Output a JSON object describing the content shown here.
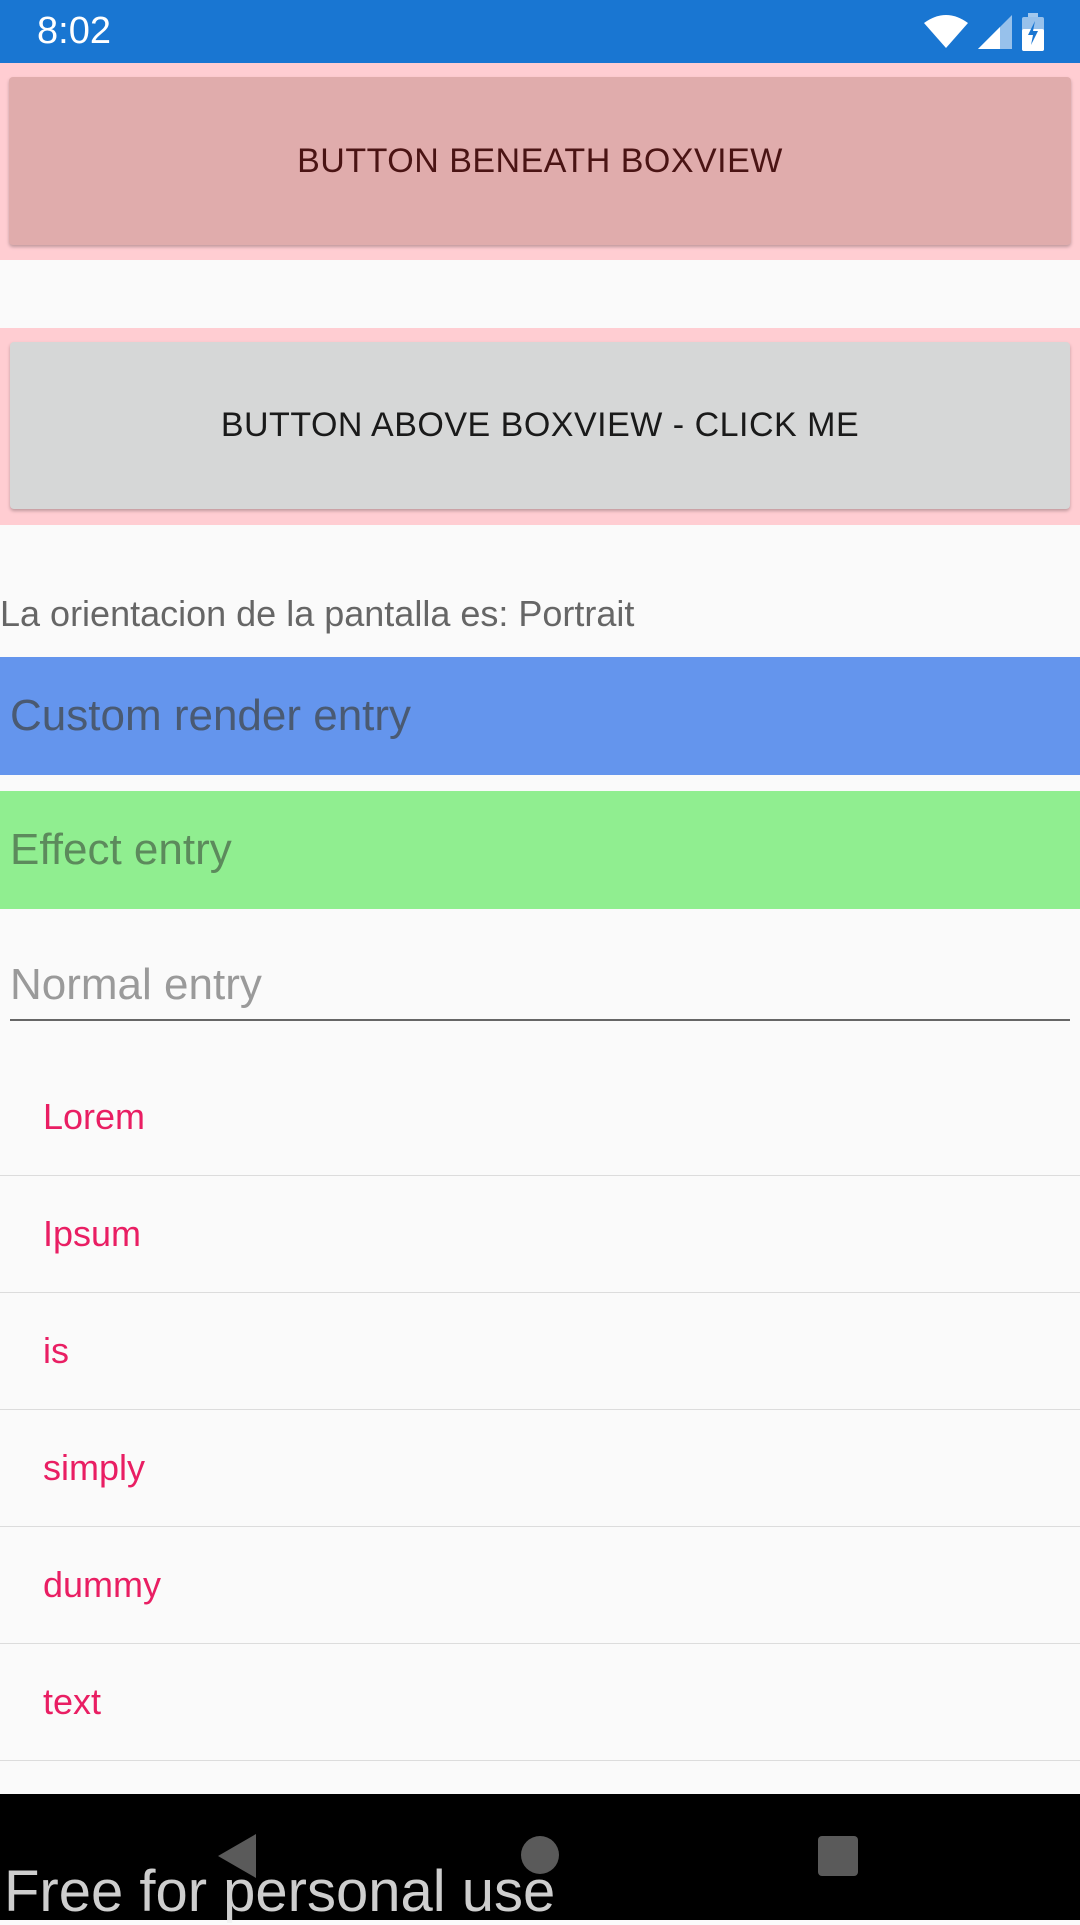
{
  "status_bar": {
    "time": "8:02",
    "icons": [
      "wifi-icon",
      "signal-icon",
      "battery-icon"
    ]
  },
  "buttons": {
    "beneath_label": "BUTTON BENEATH BOXVIEW",
    "above_label": "BUTTON ABOVE BOXVIEW - CLICK ME"
  },
  "orientation_text": "La orientacion de la pantalla es: Portrait",
  "entries": {
    "custom_placeholder": "Custom render entry",
    "effect_placeholder": "Effect entry",
    "normal_placeholder": "Normal entry"
  },
  "list": {
    "items": [
      "Lorem",
      "Ipsum",
      "is",
      "simply",
      "dummy",
      "text"
    ]
  },
  "nav_bar": {
    "icons": [
      "back-icon",
      "home-icon",
      "recents-icon"
    ]
  },
  "watermark": "Free for personal use",
  "colors": {
    "status_bar": "#1976d2",
    "boxview": "#ffcdd2",
    "custom_entry_bg": "#6495ed",
    "effect_entry_bg": "#90ee90",
    "list_text": "#e91e63"
  }
}
